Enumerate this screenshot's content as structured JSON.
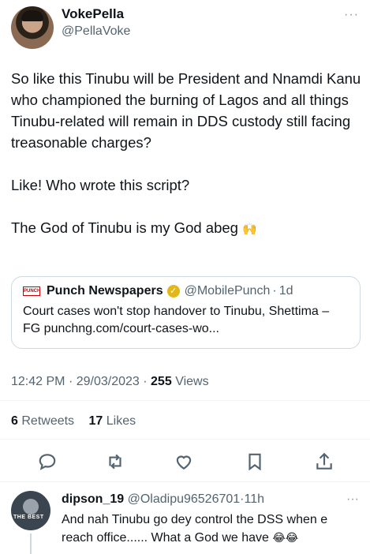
{
  "tweet": {
    "author_name": "VokePella",
    "author_handle": "@PellaVoke",
    "more": "···",
    "paragraphs": [
      "So like this Tinubu will be President and Nnamdi Kanu who championed the burning of Lagos and all things Tinubu-related will remain in DDS custody still facing treasonable charges?",
      "Like! Who wrote this script?",
      "The God of Tinubu is my God abeg"
    ],
    "pray_emoji": "🙌",
    "time": "12:42 PM",
    "date": "29/03/2023",
    "views_count": "255",
    "views_label": "Views",
    "retweets_count": "6",
    "retweets_label": "Retweets",
    "likes_count": "17",
    "likes_label": "Likes",
    "separator": "·"
  },
  "quote": {
    "logo_text": "PUNCH",
    "name": "Punch Newspapers",
    "handle": "@MobilePunch",
    "time": "1d",
    "text": "Court cases won't stop handover to Tinubu, Shettima – FG punchng.com/court-cases-wo..."
  },
  "actions": [
    {
      "name": "reply-icon"
    },
    {
      "name": "retweet-icon"
    },
    {
      "name": "like-icon"
    },
    {
      "name": "bookmark-icon"
    },
    {
      "name": "share-icon"
    }
  ],
  "reply": {
    "avatar_text": "THE BEST",
    "name": "dipson_19",
    "handle": "@Oladipu96526701",
    "time": "11h",
    "text": "And nah Tinubu go dey control the DSS when e reach office...... What a God we have",
    "emoji": "😂😂",
    "more": "···"
  },
  "colors": {
    "text": "#0f1419",
    "secondary": "#536471",
    "border": "#cfd9de",
    "verified_gold": "#e2b719"
  }
}
